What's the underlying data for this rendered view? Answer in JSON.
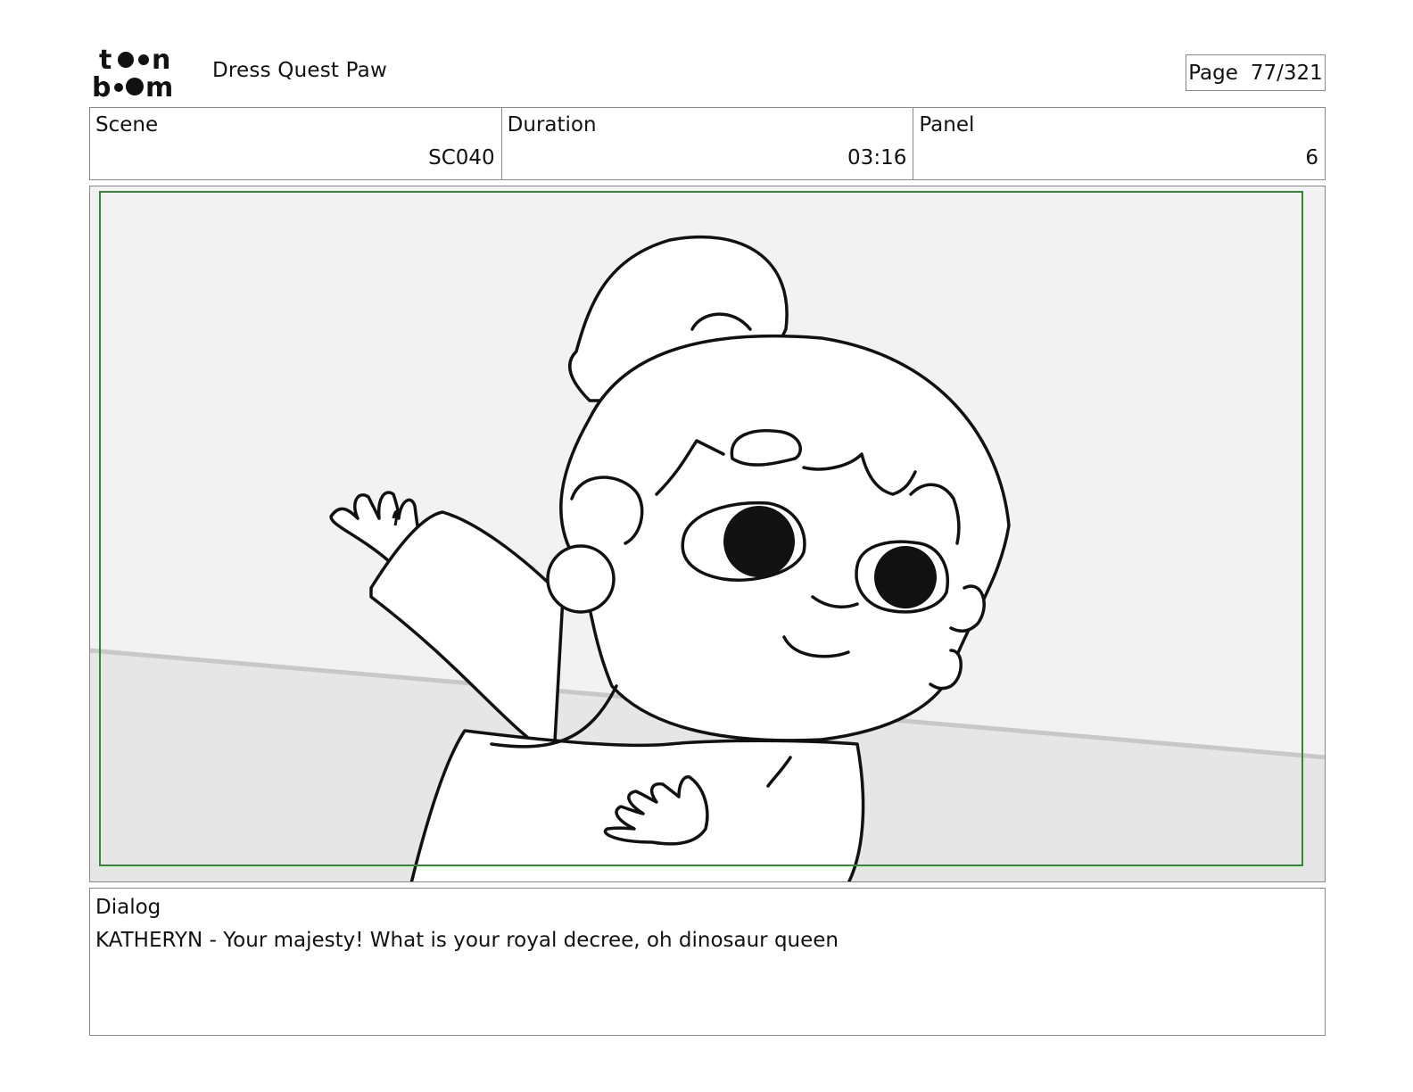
{
  "header": {
    "logo_alt": "toon boom",
    "project_title": "Dress Quest Paw",
    "page_label": "Page",
    "page_value": "77/321"
  },
  "info": {
    "scene_label": "Scene",
    "scene_value": "SC040",
    "duration_label": "Duration",
    "duration_value": "03:16",
    "panel_label": "Panel",
    "panel_value": "6"
  },
  "panel_image": {
    "frame_color": "#2e8b2e",
    "description_icon": "storyboard-drawing"
  },
  "dialog": {
    "label": "Dialog",
    "text": "KATHERYN - Your majesty! What is your royal decree, oh dinosaur queen"
  }
}
